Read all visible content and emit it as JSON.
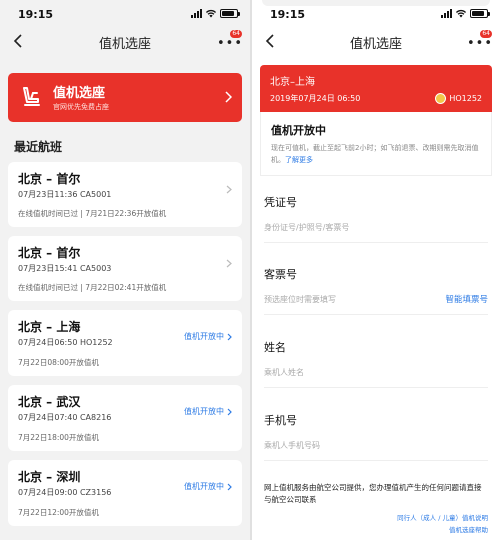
{
  "left": {
    "status_time": "19:15",
    "nav_title": "值机选座",
    "more_badge": "64",
    "banner": {
      "title": "值机选座",
      "subtitle": "官网优先免费占座"
    },
    "section_title": "最近航班",
    "flights": [
      {
        "route": "北京 – 首尔",
        "info": "07月23日11:36 CA5001",
        "status": "",
        "foot": "在线值机时间已过 | 7月21日22:36开放值机"
      },
      {
        "route": "北京 – 首尔",
        "info": "07月23日15:41 CA5003",
        "status": "",
        "foot": "在线值机时间已过 | 7月22日02:41开放值机"
      },
      {
        "route": "北京 – 上海",
        "info": "07月24日06:50 HO1252",
        "status": "值机开放中",
        "foot": "7月22日08:00开放值机"
      },
      {
        "route": "北京 – 武汉",
        "info": "07月24日07:40 CA8216",
        "status": "值机开放中",
        "foot": "7月22日18:00开放值机"
      },
      {
        "route": "北京 – 深圳",
        "info": "07月24日09:00 CZ3156",
        "status": "值机开放中",
        "foot": "7月22日12:00开放值机"
      }
    ]
  },
  "right": {
    "status_time": "19:15",
    "nav_title": "值机选座",
    "more_badge": "64",
    "flight": {
      "route": "北京–上海",
      "datetime": "2019年07月24日 06:50",
      "flight_no": "HO1252"
    },
    "open": {
      "title": "值机开放中",
      "desc": "现在可值机，截止至起飞前2小时；如飞前退票、改期则需先取消值机。",
      "link": "了解更多"
    },
    "fields": [
      {
        "label": "凭证号",
        "placeholder": "身份证号/护照号/客票号",
        "action": ""
      },
      {
        "label": "客票号",
        "placeholder": "预选座位时需要填写",
        "action": "智能填票号"
      },
      {
        "label": "姓名",
        "placeholder": "乘机人姓名",
        "action": ""
      },
      {
        "label": "手机号",
        "placeholder": "乘机人手机号码",
        "action": ""
      }
    ],
    "footnote": "网上值机服务由航空公司提供，您办理值机产生的任何问题请直接与航空公司联系",
    "links": [
      "同行人（成人 / 儿童）值机说明",
      "值机选座帮助"
    ]
  },
  "colors": {
    "accent": "#e8322a",
    "link": "#2d7be5",
    "background": "#f2f2f2"
  },
  "icons": [
    "back-chevron-icon",
    "more-dots-icon",
    "seat-icon",
    "chevron-right-icon",
    "signal-icon",
    "wifi-icon",
    "battery-icon",
    "airline-logo-icon"
  ]
}
